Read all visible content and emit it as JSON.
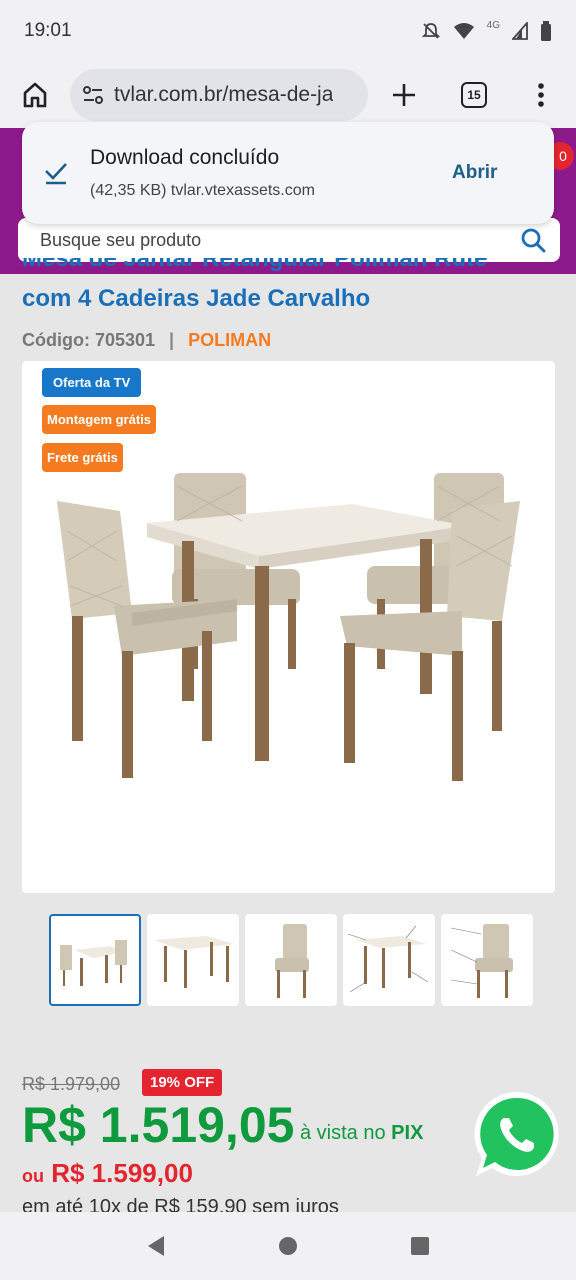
{
  "status_bar": {
    "time": "19:01",
    "network_label": "4G",
    "icons": [
      "dnd-off-icon",
      "wifi-icon",
      "signal-icon",
      "battery-icon"
    ]
  },
  "browser": {
    "url": "tvlar.com.br/mesa-de-ja",
    "tab_count": "15",
    "icons": [
      "home-icon",
      "site-settings-icon",
      "plus-icon",
      "tabs-icon",
      "more-vert-icon"
    ]
  },
  "header": {
    "cart_count": "0",
    "search_placeholder": "Busque seu produto",
    "brand_color": "#8d1a8a"
  },
  "download_toast": {
    "title": "Download concluído",
    "subtitle": "(42,35 KB) tvlar.vtexassets.com",
    "action_label": "Abrir"
  },
  "product": {
    "title_line1": "Mesa de Jantar Retangular Poliman Rute",
    "title_line2": "com 4 Cadeiras Jade Carvalho",
    "code_label": "Código: 705301",
    "separator": "|",
    "brand": "POLIMAN",
    "badges": {
      "tv": "Oferta da TV",
      "assembly": "Montagem grátis",
      "shipping": "Frete grátis"
    }
  },
  "pricing": {
    "old_price": "R$ 1.979,00",
    "discount": "19% OFF",
    "pix_price": "R$ 1.519,05",
    "pix_suffix_prefix": "à vista no",
    "pix_suffix_method": "PIX",
    "alt_prefix": "ou",
    "alt_price": "R$ 1.599,00",
    "installments": "em até 10x de R$ 159,90 sem juros"
  },
  "colors": {
    "accent_blue": "#1b6fb8",
    "orange": "#f47b20",
    "green": "#0e9a3d",
    "red": "#e4242f"
  }
}
